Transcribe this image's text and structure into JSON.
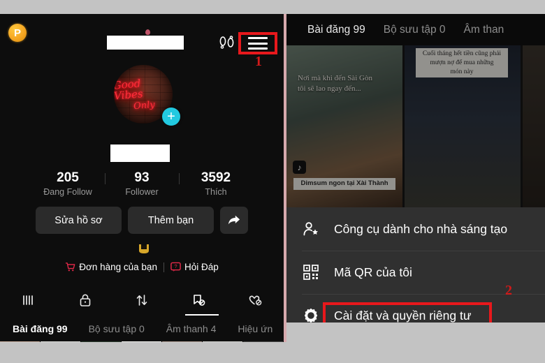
{
  "left": {
    "coin_label": "P",
    "annotation_1": "1",
    "avatar": {
      "neon_line1": "Good Vibes",
      "neon_line2": "Only",
      "add_label": "+"
    },
    "stats": [
      {
        "num": "205",
        "label": "Đang Follow"
      },
      {
        "num": "93",
        "label": "Follower"
      },
      {
        "num": "3592",
        "label": "Thích"
      }
    ],
    "actions": [
      {
        "label": "Sửa hồ sơ"
      },
      {
        "label": "Thêm bạn"
      }
    ],
    "links": [
      {
        "label": "Đơn hàng của bạn",
        "icon": "cart-icon"
      },
      {
        "label": "Hỏi Đáp",
        "icon": "question-bubble-icon"
      }
    ],
    "content_tabs": [
      {
        "label": "Bài đăng 99",
        "active": true
      },
      {
        "label": "Bộ sưu tập 0",
        "active": false
      },
      {
        "label": "Âm thanh 4",
        "active": false
      },
      {
        "label": "Hiệu ứn",
        "active": false
      }
    ],
    "icon_tabs": [
      "grid-icon",
      "lock-icon",
      "repost-icon",
      "bookmark-off-icon",
      "heart-off-icon"
    ]
  },
  "right": {
    "tabs": [
      {
        "label": "Bài đăng 99",
        "active": true
      },
      {
        "label": "Bộ sưu tập 0",
        "active": false
      },
      {
        "label": "Âm than",
        "active": false
      }
    ],
    "thumbnails": [
      {
        "overlay": "Nơi mà khi đến Sài Gòn\ntôi sẽ lao ngay đến...",
        "caption": "Dimsum ngon tại Xài Thành"
      },
      {
        "caption": "Cuối tháng hết tiền cũng phải\nmượn nợ để mua những\nmón này"
      },
      {
        "caption": ""
      }
    ],
    "menu": [
      {
        "label": "Công cụ dành cho nhà sáng tạo",
        "icon": "person-star-icon",
        "highlighted": false
      },
      {
        "label": "Mã QR của tôi",
        "icon": "qr-code-icon",
        "highlighted": false
      },
      {
        "label": "Cài đặt và quyền riêng tư",
        "icon": "gear-icon",
        "highlighted": true
      }
    ],
    "annotation_2": "2"
  },
  "colors": {
    "annotation_red": "#e8181c",
    "accent_cyan": "#22c9e0",
    "coin_gold": "#f5a623",
    "link_red": "#e8294a"
  }
}
